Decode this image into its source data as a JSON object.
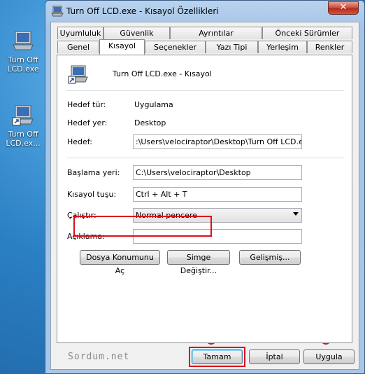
{
  "desktop": {
    "icons": [
      {
        "label": "Turn Off LCD.exe"
      },
      {
        "label": "Turn Off LCD.ex..."
      }
    ]
  },
  "window": {
    "title": "Turn Off LCD.exe - Kısayol Özellikleri",
    "close_label": "✕"
  },
  "tabs": {
    "row1": [
      "Uyumluluk",
      "Güvenlik",
      "Ayrıntılar",
      "Önceki Sürümler"
    ],
    "row2": [
      "Genel",
      "Kısayol",
      "Seçenekler",
      "Yazı Tipi",
      "Yerleşim",
      "Renkler"
    ],
    "active": "Kısayol"
  },
  "header": {
    "name": "Turn Off LCD.exe - Kısayol"
  },
  "fields": {
    "target_type_label": "Hedef tür:",
    "target_type_value": "Uygulama",
    "target_location_label": "Hedef yer:",
    "target_location_value": "Desktop",
    "target_label": "Hedef:",
    "target_value": ":\\Users\\velociraptor\\Desktop\\Turn Off LCD.exe\"",
    "start_in_label": "Başlama yeri:",
    "start_in_value": "C:\\Users\\velociraptor\\Desktop",
    "shortcut_key_label": "Kısayol tuşu:",
    "shortcut_key_value": "Ctrl + Alt + T",
    "run_label": "Çalıştır:",
    "run_value": "Normal pencere",
    "comment_label": "Açıklama:",
    "comment_value": ""
  },
  "buttons": {
    "open_location": "Dosya Konumunu Aç",
    "change_icon": "Simge Değiştir...",
    "advanced": "Gelişmiş...",
    "ok": "Tamam",
    "cancel": "İptal",
    "apply": "Uygula"
  },
  "watermark": "Sordum.net",
  "colors": {
    "highlight": "#d9121a",
    "marker_dot": "#e21212"
  }
}
